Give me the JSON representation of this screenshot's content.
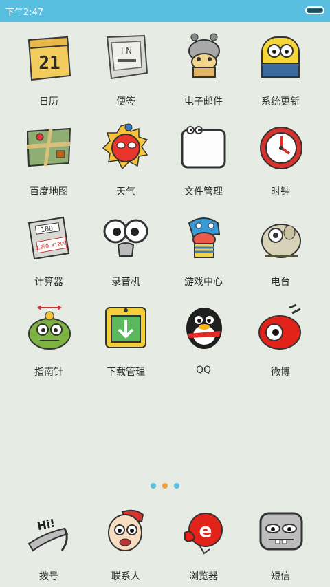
{
  "status_bar": {
    "time": "下午2:47"
  },
  "apps": [
    {
      "label": "日历",
      "icon": "calendar-icon"
    },
    {
      "label": "便签",
      "icon": "notes-icon"
    },
    {
      "label": "电子邮件",
      "icon": "email-icon"
    },
    {
      "label": "系统更新",
      "icon": "system-update-icon"
    },
    {
      "label": "百度地图",
      "icon": "map-icon"
    },
    {
      "label": "天气",
      "icon": "weather-sun-icon"
    },
    {
      "label": "文件管理",
      "icon": "file-manager-icon"
    },
    {
      "label": "时钟",
      "icon": "clock-icon"
    },
    {
      "label": "计算器",
      "icon": "calculator-icon"
    },
    {
      "label": "录音机",
      "icon": "recorder-icon"
    },
    {
      "label": "游戏中心",
      "icon": "game-center-icon"
    },
    {
      "label": "电台",
      "icon": "radio-icon"
    },
    {
      "label": "指南针",
      "icon": "compass-icon"
    },
    {
      "label": "下载管理",
      "icon": "download-icon"
    },
    {
      "label": "QQ",
      "icon": "qq-penguin-icon"
    },
    {
      "label": "微博",
      "icon": "weibo-icon"
    }
  ],
  "page_indicator": {
    "count": 3,
    "active": 1,
    "colors": [
      "#5bbfe0",
      "#f0a23a",
      "#5bbfe0"
    ]
  },
  "dock": [
    {
      "label": "拨号",
      "icon": "phone-icon"
    },
    {
      "label": "联系人",
      "icon": "contacts-icon"
    },
    {
      "label": "浏览器",
      "icon": "browser-icon"
    },
    {
      "label": "短信",
      "icon": "sms-icon"
    }
  ],
  "icon_text": {
    "calendar_day": "21",
    "calculator_display": "100",
    "calculator_receipt": "工资条 ¥1200",
    "phone_hi": "Hi!",
    "browser_letter": "e"
  }
}
